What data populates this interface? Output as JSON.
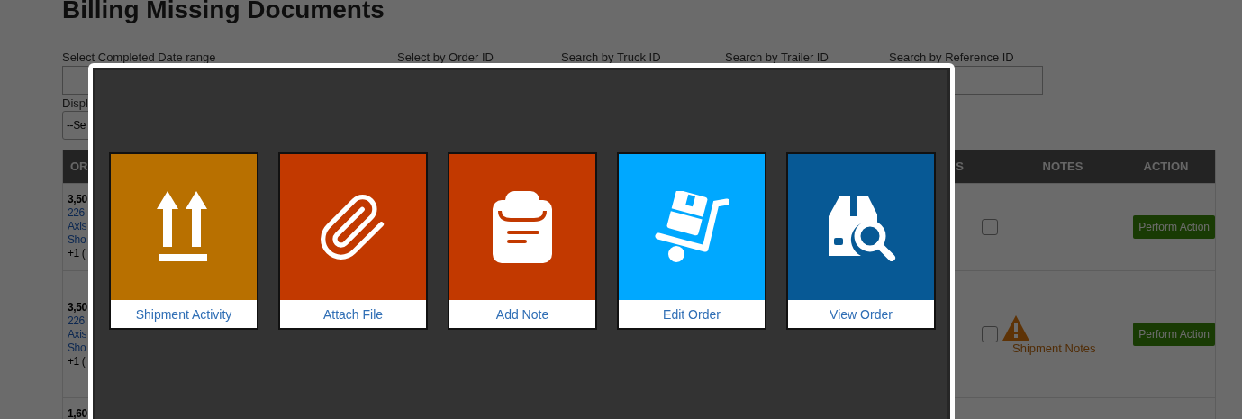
{
  "page": {
    "title": "Billing Missing Documents"
  },
  "filters": [
    {
      "label": "Select Completed Date range"
    },
    {
      "label": "Select by Order ID"
    },
    {
      "label": "Search by Truck ID"
    },
    {
      "label": "Search by Trailer ID"
    },
    {
      "label": "Search by Reference ID"
    }
  ],
  "display": {
    "label": "Displ",
    "value": "--Se"
  },
  "table": {
    "columns": [
      {
        "label": "OR"
      },
      {
        "label": "S"
      },
      {
        "label": "NOTES"
      },
      {
        "label": "ACTION"
      }
    ],
    "rows": [
      {
        "lines": [
          {
            "text": "3,50",
            "kind": "bold"
          },
          {
            "text": "226",
            "kind": "link"
          },
          {
            "text": "Axis",
            "kind": "link"
          },
          {
            "text": "Sho",
            "kind": "link"
          },
          {
            "text": "+1 (",
            "kind": "plain"
          }
        ],
        "checked": false,
        "action": "Perform Action"
      },
      {
        "lines": [
          {
            "text": "3,50",
            "kind": "bold"
          },
          {
            "text": "226",
            "kind": "link"
          },
          {
            "text": "Axis",
            "kind": "link"
          },
          {
            "text": "Sho",
            "kind": "link"
          },
          {
            "text": "+1 (",
            "kind": "plain"
          }
        ],
        "checked": false,
        "notes": {
          "warning": true,
          "label": "Shipment Notes"
        },
        "action": "Perform Action"
      },
      {
        "lines": [
          {
            "text": "1,60",
            "kind": "bold"
          }
        ]
      }
    ]
  },
  "modal": {
    "tiles": [
      {
        "label": "Shipment Activity",
        "color": "#b87000",
        "kind": "arrows"
      },
      {
        "label": "Attach File",
        "color": "#c23900",
        "kind": "paperclip"
      },
      {
        "label": "Add Note",
        "color": "#c23900",
        "kind": "clipboard"
      },
      {
        "label": "Edit Order",
        "color": "#00a8ff",
        "kind": "trolley"
      },
      {
        "label": "View Order",
        "color": "#075995",
        "kind": "box-search"
      }
    ]
  }
}
